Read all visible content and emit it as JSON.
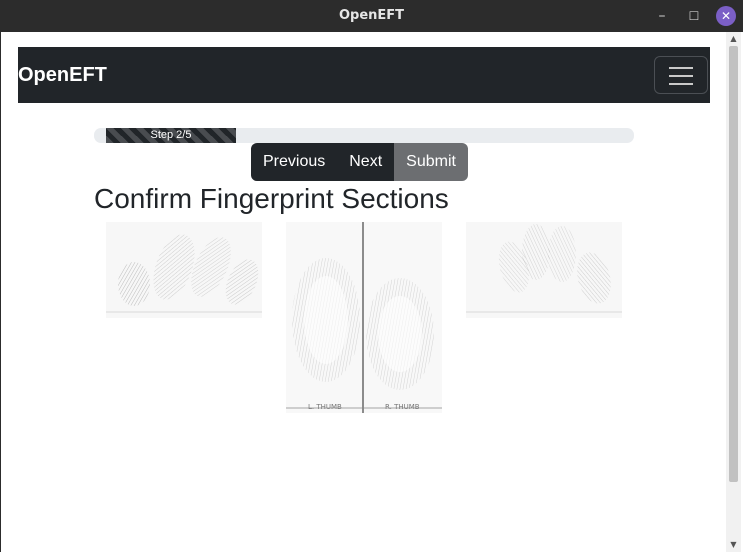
{
  "window": {
    "title": "OpenEFT",
    "minimize_glyph": "–",
    "maximize_glyph": "☐",
    "close_glyph": "✕"
  },
  "navbar": {
    "brand": "OpenEFT",
    "toggler_icon": "hamburger-menu-icon"
  },
  "progress": {
    "label": "Step 2/5",
    "fraction": 0.24
  },
  "buttons": {
    "previous": "Previous",
    "next": "Next",
    "submit": "Submit"
  },
  "heading": "Confirm Fingerprint Sections",
  "images": {
    "left_thumb_caption": "L. THUMB",
    "right_thumb_caption": "R. THUMB"
  },
  "colors": {
    "navbar_bg": "#212529",
    "close_button": "#7b5fc6",
    "submit_active": "#6c6e71"
  }
}
